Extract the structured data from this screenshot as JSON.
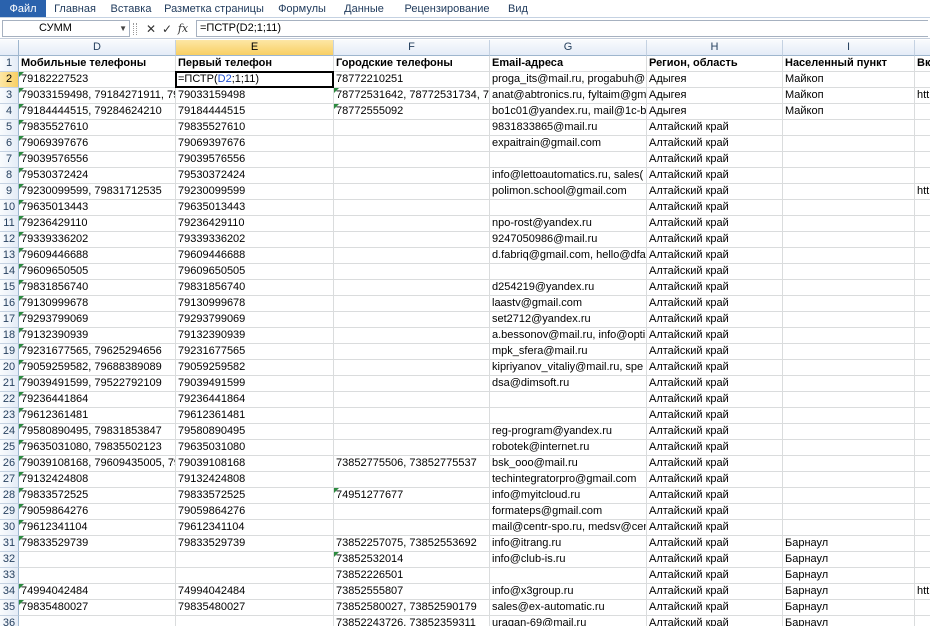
{
  "ribbon_tabs": [
    "Файл",
    "Главная",
    "Вставка",
    "Разметка страницы",
    "Формулы",
    "Данные",
    "Рецензирование",
    "Вид"
  ],
  "formula_bar": {
    "name_box": "СУММ",
    "cancel_glyph": "✕",
    "enter_glyph": "✓",
    "fx_label": "fx",
    "formula": "=ПСТР(D2;1;11)"
  },
  "columns": [
    {
      "letter": "D",
      "header": "Мобильные телефоны"
    },
    {
      "letter": "E",
      "header": "Первый телефон"
    },
    {
      "letter": "F",
      "header": "Городские телефоны"
    },
    {
      "letter": "G",
      "header": "Email-адреса"
    },
    {
      "letter": "H",
      "header": "Регион, область"
    },
    {
      "letter": "I",
      "header": "Населенный пункт"
    },
    {
      "letter": "",
      "header": "Вк"
    }
  ],
  "active_cell": {
    "prefix": "=ПСТР(",
    "ref": "D2",
    "suffix": ";1;11)"
  },
  "rows": [
    {
      "n": "2",
      "d": "79182227523",
      "e": "",
      "f": "78772210251",
      "g": "proga_its@mail.ru, progabuh@",
      "h": "Адыгея",
      "i": "Майкоп",
      "j": ""
    },
    {
      "n": "3",
      "d": "79033159498, 79184271911, 7928",
      "e": "79033159498",
      "f": "78772531642, 78772531734, 7877",
      "g": "anat@abtronics.ru, fyltaim@gm",
      "h": "Адыгея",
      "i": "Майкоп",
      "j": "htt"
    },
    {
      "n": "4",
      "d": "79184444515, 79284624210",
      "e": "79184444515",
      "f": "78772555092",
      "g": "bo1c01@yandex.ru, mail@1c-br",
      "h": "Адыгея",
      "i": "Майкоп",
      "j": ""
    },
    {
      "n": "5",
      "d": "79835527610",
      "e": "79835527610",
      "f": "",
      "g": "9831833865@mail.ru",
      "h": "Алтайский край",
      "i": "",
      "j": ""
    },
    {
      "n": "6",
      "d": "79069397676",
      "e": "79069397676",
      "f": "",
      "g": "expaitrain@gmail.com",
      "h": "Алтайский край",
      "i": "",
      "j": ""
    },
    {
      "n": "7",
      "d": "79039576556",
      "e": "79039576556",
      "f": "",
      "g": "",
      "h": "Алтайский край",
      "i": "",
      "j": ""
    },
    {
      "n": "8",
      "d": "79530372424",
      "e": "79530372424",
      "f": "",
      "g": "info@lettoautomatics.ru, sales(",
      "h": "Алтайский край",
      "i": "",
      "j": ""
    },
    {
      "n": "9",
      "d": "79230099599, 79831712535",
      "e": "79230099599",
      "f": "",
      "g": "polimon.school@gmail.com",
      "h": "Алтайский край",
      "i": "",
      "j": "htt"
    },
    {
      "n": "10",
      "d": "79635013443",
      "e": "79635013443",
      "f": "",
      "g": "",
      "h": "Алтайский край",
      "i": "",
      "j": ""
    },
    {
      "n": "11",
      "d": "79236429110",
      "e": "79236429110",
      "f": "",
      "g": "npo-rost@yandex.ru",
      "h": "Алтайский край",
      "i": "",
      "j": ""
    },
    {
      "n": "12",
      "d": "79339336202",
      "e": "79339336202",
      "f": "",
      "g": "9247050986@mail.ru",
      "h": "Алтайский край",
      "i": "",
      "j": ""
    },
    {
      "n": "13",
      "d": "79609446688",
      "e": "79609446688",
      "f": "",
      "g": "d.fabriq@gmail.com, hello@dfa",
      "h": "Алтайский край",
      "i": "",
      "j": ""
    },
    {
      "n": "14",
      "d": "79609650505",
      "e": "79609650505",
      "f": "",
      "g": "",
      "h": "Алтайский край",
      "i": "",
      "j": ""
    },
    {
      "n": "15",
      "d": "79831856740",
      "e": "79831856740",
      "f": "",
      "g": "d254219@yandex.ru",
      "h": "Алтайский край",
      "i": "",
      "j": ""
    },
    {
      "n": "16",
      "d": "79130999678",
      "e": "79130999678",
      "f": "",
      "g": "laastv@gmail.com",
      "h": "Алтайский край",
      "i": "",
      "j": ""
    },
    {
      "n": "17",
      "d": "79293799069",
      "e": "79293799069",
      "f": "",
      "g": "set2712@yandex.ru",
      "h": "Алтайский край",
      "i": "",
      "j": ""
    },
    {
      "n": "18",
      "d": "79132390939",
      "e": "79132390939",
      "f": "",
      "g": "a.bessonov@mail.ru, info@opti",
      "h": "Алтайский край",
      "i": "",
      "j": ""
    },
    {
      "n": "19",
      "d": "79231677565, 79625294656",
      "e": "79231677565",
      "f": "",
      "g": "mpk_sfera@mail.ru",
      "h": "Алтайский край",
      "i": "",
      "j": ""
    },
    {
      "n": "20",
      "d": "79059259582, 79688389089",
      "e": "79059259582",
      "f": "",
      "g": "kipriyanov_vitaliy@mail.ru, spe",
      "h": "Алтайский край",
      "i": "",
      "j": ""
    },
    {
      "n": "21",
      "d": "79039491599, 79522792109",
      "e": "79039491599",
      "f": "",
      "g": "dsa@dimsoft.ru",
      "h": "Алтайский край",
      "i": "",
      "j": ""
    },
    {
      "n": "22",
      "d": "79236441864",
      "e": "79236441864",
      "f": "",
      "g": "",
      "h": "Алтайский край",
      "i": "",
      "j": ""
    },
    {
      "n": "23",
      "d": "79612361481",
      "e": "79612361481",
      "f": "",
      "g": "",
      "h": "Алтайский край",
      "i": "",
      "j": ""
    },
    {
      "n": "24",
      "d": "79580890495, 79831853847",
      "e": "79580890495",
      "f": "",
      "g": "reg-program@yandex.ru",
      "h": "Алтайский край",
      "i": "",
      "j": ""
    },
    {
      "n": "25",
      "d": "79635031080, 79835502123",
      "e": "79635031080",
      "f": "",
      "g": "robotek@internet.ru",
      "h": "Алтайский край",
      "i": "",
      "j": ""
    },
    {
      "n": "26",
      "d": "79039108168, 79609435005, 7960",
      "e": "79039108168",
      "f": "73852775506, 73852775537",
      "g": "bsk_ooo@mail.ru",
      "h": "Алтайский край",
      "i": "",
      "j": ""
    },
    {
      "n": "27",
      "d": "79132424808",
      "e": "79132424808",
      "f": "",
      "g": "techintegratorpro@gmail.com",
      "h": "Алтайский край",
      "i": "",
      "j": ""
    },
    {
      "n": "28",
      "d": "79833572525",
      "e": "79833572525",
      "f": "74951277677",
      "g": "info@myitcloud.ru",
      "h": "Алтайский край",
      "i": "",
      "j": ""
    },
    {
      "n": "29",
      "d": "79059864276",
      "e": "79059864276",
      "f": "",
      "g": "formateps@gmail.com",
      "h": "Алтайский край",
      "i": "",
      "j": ""
    },
    {
      "n": "30",
      "d": "79612341104",
      "e": "79612341104",
      "f": "",
      "g": "mail@centr-spo.ru, medsv@cer",
      "h": "Алтайский край",
      "i": "",
      "j": ""
    },
    {
      "n": "31",
      "d": "79833529739",
      "e": "79833529739",
      "f": "73852257075, 73852553692",
      "g": "info@itrang.ru",
      "h": "Алтайский край",
      "i": "Барнаул",
      "j": ""
    },
    {
      "n": "32",
      "d": "",
      "e": "",
      "f": "73852532014",
      "g": "info@club-is.ru",
      "h": "Алтайский край",
      "i": "Барнаул",
      "j": ""
    },
    {
      "n": "33",
      "d": "",
      "e": "",
      "f": "73852226501",
      "g": "",
      "h": "Алтайский край",
      "i": "Барнаул",
      "j": ""
    },
    {
      "n": "34",
      "d": "74994042484",
      "e": "74994042484",
      "f": "73852555807",
      "g": "info@x3group.ru",
      "h": "Алтайский край",
      "i": "Барнаул",
      "j": "htt"
    },
    {
      "n": "35",
      "d": "79835480027",
      "e": "79835480027",
      "f": "73852580027, 73852590179",
      "g": "sales@ex-automatic.ru",
      "h": "Алтайский край",
      "i": "Барнаул",
      "j": ""
    },
    {
      "n": "36",
      "d": "",
      "e": "",
      "f": "73852243726, 73852359311",
      "g": "uragan-69@mail.ru",
      "h": "Алтайский край",
      "i": "Барнаул",
      "j": ""
    }
  ],
  "text_marker_rows": [
    "2",
    "3",
    "4",
    "5",
    "6",
    "7",
    "8",
    "9",
    "10",
    "11",
    "12",
    "13",
    "14",
    "15",
    "16",
    "17",
    "18",
    "19",
    "20",
    "21",
    "22",
    "23",
    "24",
    "25",
    "26",
    "27",
    "28",
    "29",
    "30",
    "31",
    "34",
    "35"
  ],
  "f_marker_rows": [
    "3",
    "4",
    "28",
    "32"
  ]
}
